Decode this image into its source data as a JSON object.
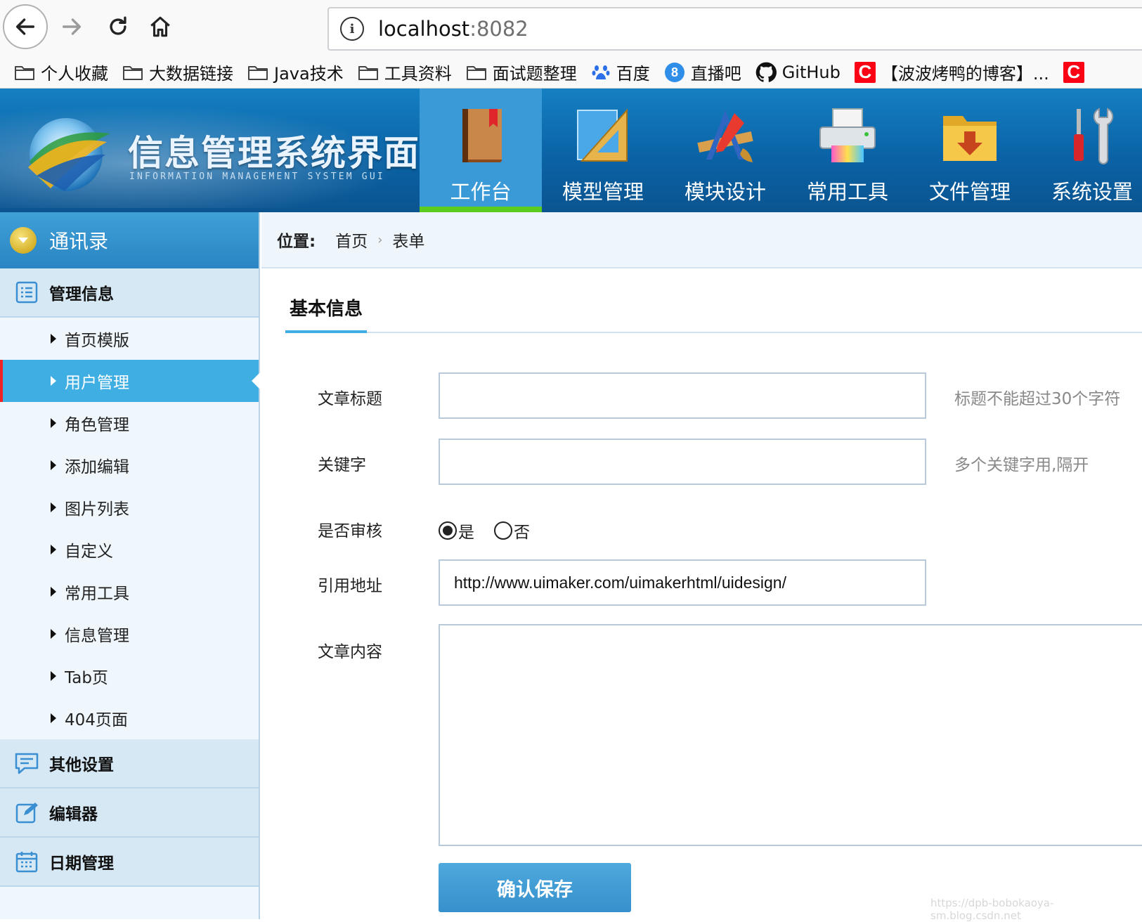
{
  "browser": {
    "url_host": "localhost",
    "url_port": ":8082",
    "bookmarks": [
      {
        "label": "个人收藏",
        "icon": "folder-icon"
      },
      {
        "label": "大数据链接",
        "icon": "folder-icon"
      },
      {
        "label": "Java技术",
        "icon": "folder-icon"
      },
      {
        "label": "工具资料",
        "icon": "folder-icon"
      },
      {
        "label": "面试题整理",
        "icon": "folder-icon"
      },
      {
        "label": "百度",
        "icon": "baidu-paw-icon"
      },
      {
        "label": "直播吧",
        "icon": "zhibo8-icon"
      },
      {
        "label": "GitHub",
        "icon": "github-icon"
      },
      {
        "label": "【波波烤鸭的博客】...",
        "icon": "csdn-icon"
      }
    ]
  },
  "header": {
    "title": "信息管理系统界面",
    "subtitle": "INFORMATION MANAGEMENT SYSTEM GUI",
    "nav": [
      {
        "label": "工作台",
        "icon": "book-icon",
        "active": true
      },
      {
        "label": "模型管理",
        "icon": "triangle-ruler-icon"
      },
      {
        "label": "模块设计",
        "icon": "design-tools-icon"
      },
      {
        "label": "常用工具",
        "icon": "printer-icon"
      },
      {
        "label": "文件管理",
        "icon": "download-folder-icon"
      },
      {
        "label": "系统设置",
        "icon": "wrench-screwdriver-icon"
      }
    ]
  },
  "sidebar": {
    "title": "通讯录",
    "sections": [
      {
        "label": "管理信息",
        "icon": "list-icon",
        "items": [
          {
            "label": "首页模版"
          },
          {
            "label": "用户管理",
            "active": true
          },
          {
            "label": "角色管理"
          },
          {
            "label": "添加编辑"
          },
          {
            "label": "图片列表"
          },
          {
            "label": "自定义"
          },
          {
            "label": "常用工具"
          },
          {
            "label": "信息管理"
          },
          {
            "label": "Tab页"
          },
          {
            "label": "404页面"
          }
        ]
      },
      {
        "label": "其他设置",
        "icon": "chat-icon",
        "items": []
      },
      {
        "label": "编辑器",
        "icon": "edit-icon",
        "items": []
      },
      {
        "label": "日期管理",
        "icon": "calendar-icon",
        "items": []
      }
    ]
  },
  "breadcrumb": {
    "label": "位置:",
    "items": [
      "首页",
      "表单"
    ]
  },
  "form": {
    "tab": "基本信息",
    "title_label": "文章标题",
    "title_value": "",
    "title_hint": "标题不能超过30个字符",
    "keyword_label": "关键字",
    "keyword_value": "",
    "keyword_hint": "多个关键字用,隔开",
    "review_label": "是否审核",
    "review_yes": "是",
    "review_no": "否",
    "review_selected": "是",
    "url_label": "引用地址",
    "url_value": "http://www.uimaker.com/uimakerhtml/uidesign/",
    "content_label": "文章内容",
    "content_value": "",
    "save_label": "确认保存"
  },
  "watermark": "https://dpb-bobokaoya-sm.blog.csdn.net",
  "colors": {
    "header_blue": "#0a63a6",
    "active_nav": "#3a9ad8",
    "active_nav_bar": "#5ccc1f",
    "sidebar_active": "#3eaee3",
    "button_blue": "#3690cc"
  }
}
